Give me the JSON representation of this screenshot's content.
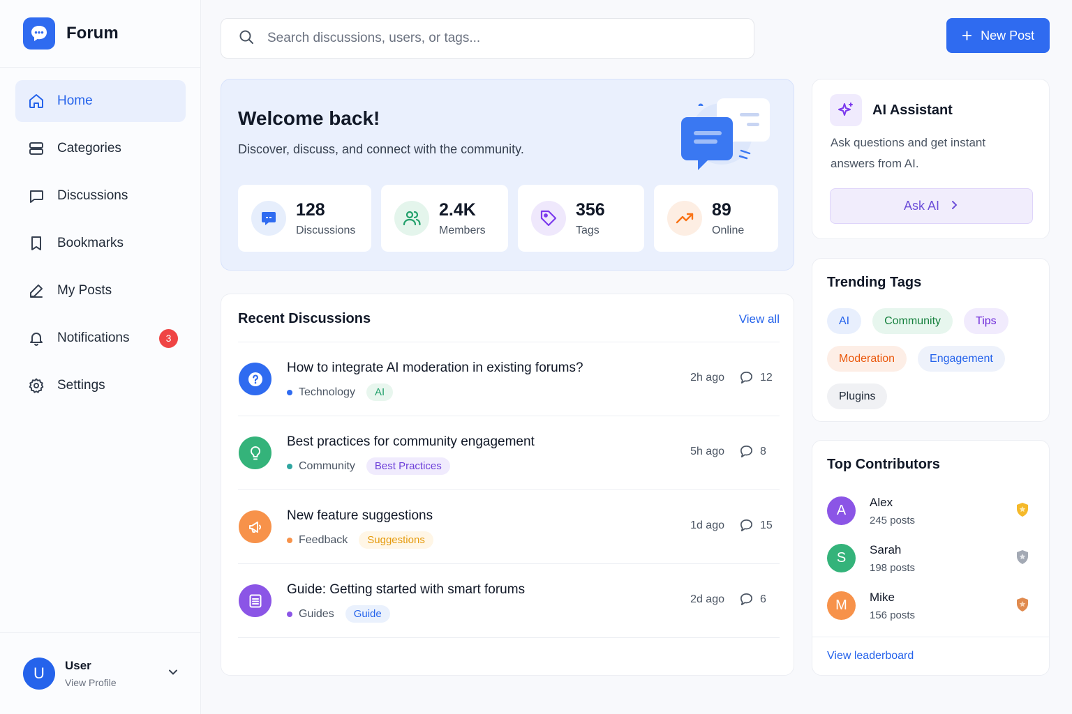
{
  "brand": {
    "name": "Forum"
  },
  "sidebar": {
    "items": [
      {
        "label": "Home",
        "icon": "home-icon",
        "active": true
      },
      {
        "label": "Categories",
        "icon": "categories-icon"
      },
      {
        "label": "Discussions",
        "icon": "chat-bubble-icon"
      },
      {
        "label": "Bookmarks",
        "icon": "bookmark-icon"
      },
      {
        "label": "My Posts",
        "icon": "pen-icon"
      },
      {
        "label": "Notifications",
        "icon": "bell-icon",
        "badge": "3"
      },
      {
        "label": "Settings",
        "icon": "gear-icon"
      }
    ]
  },
  "user": {
    "initial": "U",
    "name": "User",
    "sub": "View Profile"
  },
  "search": {
    "placeholder": "Search discussions, users, or tags..."
  },
  "header": {
    "new_post_label": "New Post"
  },
  "welcome": {
    "title": "Welcome back!",
    "subtitle": "Discover, discuss, and connect with the community.",
    "stats": [
      {
        "value": "128",
        "label": "Discussions",
        "icon": "chat-icon",
        "color": "#2f6bf0"
      },
      {
        "value": "2.4K",
        "label": "Members",
        "icon": "users-icon",
        "color": "#22a06b"
      },
      {
        "value": "356",
        "label": "Tags",
        "icon": "tag-icon",
        "color": "#7c3aed"
      },
      {
        "value": "89",
        "label": "Online",
        "icon": "trending-up-icon",
        "color": "#f97316"
      }
    ]
  },
  "recent": {
    "title": "Recent Discussions",
    "view_all": "View all",
    "items": [
      {
        "title": "How to integrate AI moderation in existing forums?",
        "category": "Technology",
        "tag": "AI",
        "time": "2h ago",
        "comments": "12",
        "icon": "question-icon",
        "color": "#2f6bf0",
        "dot": "#2f6bf0",
        "tag_bg": "#e8f6ee",
        "tag_fg": "#22a06b"
      },
      {
        "title": "Best practices for community engagement",
        "category": "Community",
        "tag": "Best Practices",
        "time": "5h ago",
        "comments": "8",
        "icon": "lightbulb-icon",
        "color": "#34b37a",
        "dot": "#2fa6a0",
        "tag_bg": "#f0ebfd",
        "tag_fg": "#6d3fd9"
      },
      {
        "title": "New feature suggestions",
        "category": "Feedback",
        "tag": "Suggestions",
        "time": "1d ago",
        "comments": "15",
        "icon": "megaphone-icon",
        "color": "#f7924a",
        "dot": "#f7924a",
        "tag_bg": "#fff6e6",
        "tag_fg": "#e59a0c"
      },
      {
        "title": "Guide: Getting started with smart forums",
        "category": "Guides",
        "tag": "Guide",
        "time": "2d ago",
        "comments": "6",
        "icon": "document-icon",
        "color": "#8b55e6",
        "dot": "#8b55e6",
        "tag_bg": "#eaf1fd",
        "tag_fg": "#2563eb"
      }
    ]
  },
  "ai": {
    "title": "AI Assistant",
    "description": "Ask questions and get instant answers from AI.",
    "button": "Ask AI"
  },
  "trending": {
    "title": "Trending Tags",
    "tags": [
      {
        "label": "AI",
        "bg": "#e8effd",
        "fg": "#2563eb"
      },
      {
        "label": "Community",
        "bg": "#e7f6ee",
        "fg": "#15803d"
      },
      {
        "label": "Tips",
        "bg": "#f1ebfd",
        "fg": "#6d28d9"
      },
      {
        "label": "Moderation",
        "bg": "#fdeee6",
        "fg": "#ea580c"
      },
      {
        "label": "Engagement",
        "bg": "#eef2fb",
        "fg": "#2563eb"
      },
      {
        "label": "Plugins",
        "bg": "#f0f1f4",
        "fg": "#1f2937"
      }
    ]
  },
  "contributors": {
    "title": "Top Contributors",
    "items": [
      {
        "initial": "A",
        "name": "Alex",
        "posts": "245 posts",
        "color": "#8b55e6",
        "badge_color": "#f5b92a"
      },
      {
        "initial": "S",
        "name": "Sarah",
        "posts": "198 posts",
        "color": "#34b37a",
        "badge_color": "#9ca3af"
      },
      {
        "initial": "M",
        "name": "Mike",
        "posts": "156 posts",
        "color": "#f7924a",
        "badge_color": "#e08a4e"
      }
    ],
    "footer_link": "View leaderboard"
  }
}
